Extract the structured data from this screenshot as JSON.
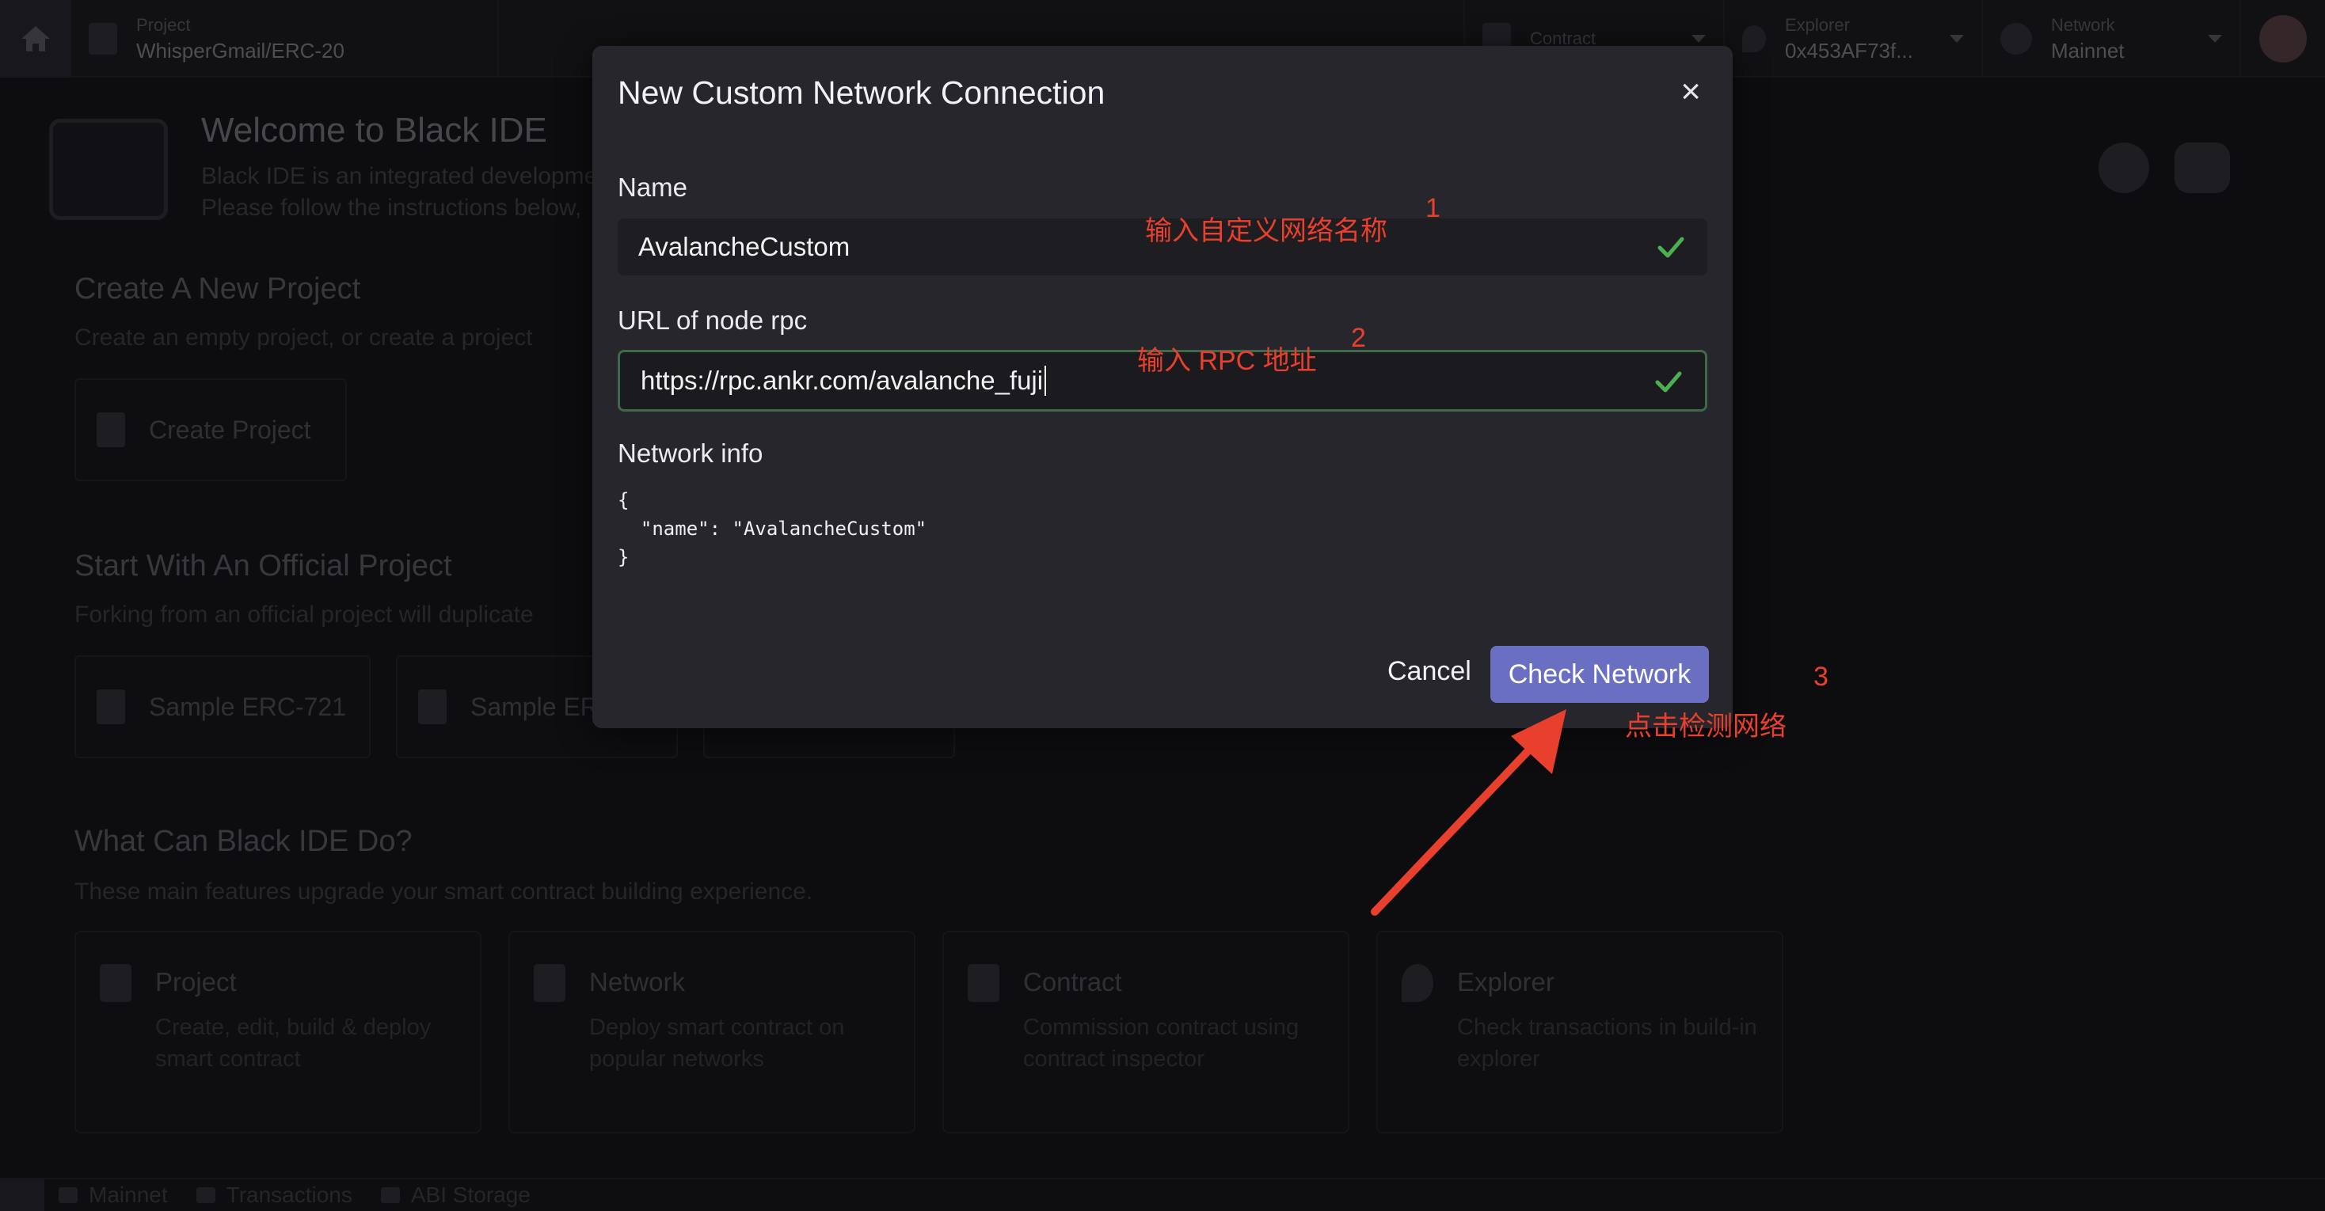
{
  "topbar": {
    "project_label": "Project",
    "project_value": "WhisperGmail/ERC-20",
    "contract_label": "Contract",
    "explorer_label": "Explorer",
    "explorer_value": "0x453AF73f...",
    "network_label": "Network",
    "network_value": "Mainnet"
  },
  "welcome": {
    "title": "Welcome to Black IDE",
    "sub1": "Black IDE is an integrated developme",
    "sub2": "Please follow the instructions below,"
  },
  "create_section": {
    "title": "Create A New Project",
    "subtitle": "Create an empty project, or create a project",
    "button": "Create Project"
  },
  "official_section": {
    "title": "Start With An Official Project",
    "subtitle": "Forking from an official project will duplicate",
    "buttons": [
      "Sample ERC-721",
      "Sample ER"
    ]
  },
  "features_section": {
    "title": "What Can Black IDE Do?",
    "subtitle": "These main features upgrade your smart contract building experience.",
    "cards": [
      {
        "title": "Project",
        "desc": "Create, edit, build & deploy smart contract"
      },
      {
        "title": "Network",
        "desc": "Deploy smart contract on popular networks"
      },
      {
        "title": "Contract",
        "desc": "Commission contract using contract inspector"
      },
      {
        "title": "Explorer",
        "desc": "Check transactions in build-in explorer"
      }
    ]
  },
  "statusbar": {
    "network": "Mainnet",
    "transactions": "Transactions",
    "abi": "ABI Storage"
  },
  "modal": {
    "title": "New Custom Network Connection",
    "close": "×",
    "name_label": "Name",
    "name_value": "AvalancheCustom",
    "url_label": "URL of node rpc",
    "url_value": "https://rpc.ankr.com/avalanche_fuji",
    "info_label": "Network info",
    "info_json": "{\n  \"name\": \"AvalancheCustom\"\n}",
    "cancel": "Cancel",
    "check_network": "Check Network"
  },
  "annotations": {
    "step1_text": "输入自定义网络名称",
    "step1_num": "1",
    "step2_text": "输入 RPC 地址",
    "step2_num": "2",
    "step3_text": "点击检测网络",
    "step3_num": "3",
    "color": "#e8402c"
  },
  "colors": {
    "accent": "#6b6fc1",
    "success": "#4caf50"
  }
}
